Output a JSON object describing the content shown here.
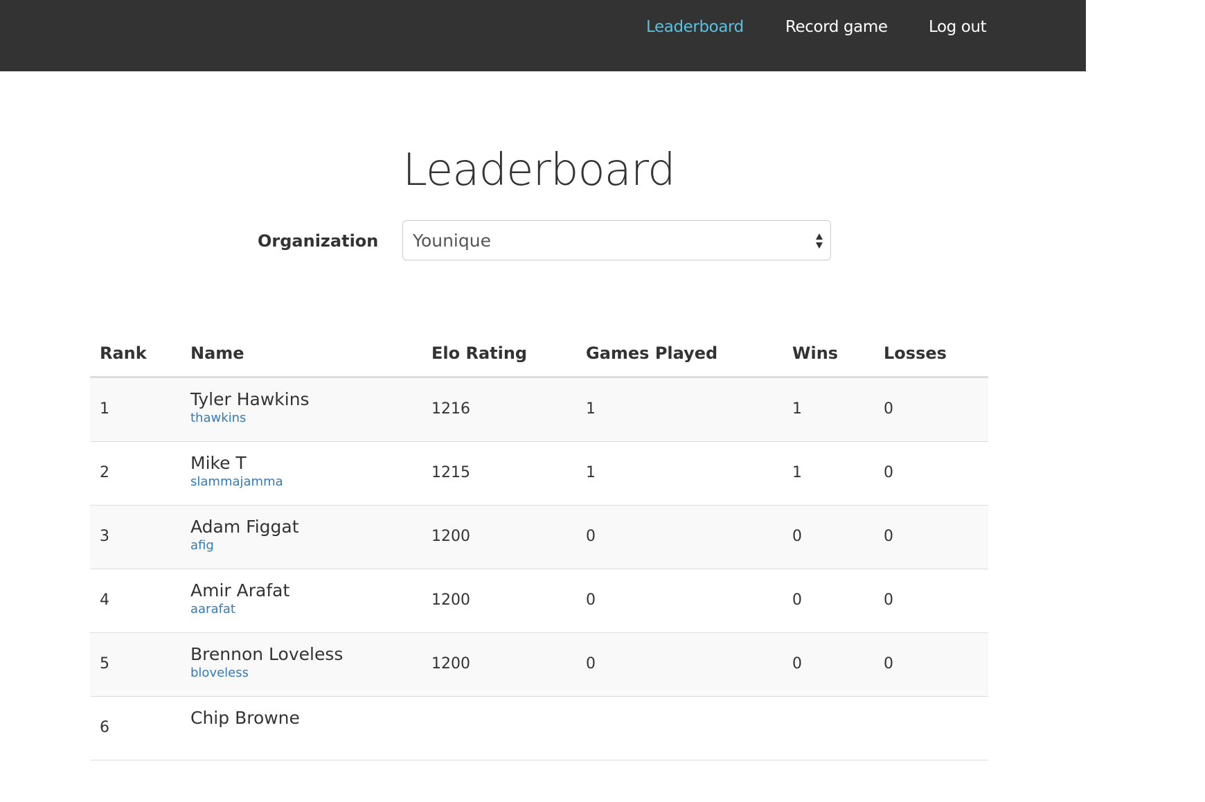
{
  "nav": {
    "items": [
      {
        "label": "Leaderboard",
        "active": true
      },
      {
        "label": "Record game",
        "active": false
      },
      {
        "label": "Log out",
        "active": false
      }
    ]
  },
  "page": {
    "title": "Leaderboard"
  },
  "organization": {
    "label": "Organization",
    "selected": "Younique"
  },
  "table": {
    "headers": {
      "rank": "Rank",
      "name": "Name",
      "elo": "Elo Rating",
      "games": "Games Played",
      "wins": "Wins",
      "losses": "Losses"
    },
    "rows": [
      {
        "rank": "1",
        "name": "Tyler Hawkins",
        "username": "thawkins",
        "elo": "1216",
        "games": "1",
        "wins": "1",
        "losses": "0"
      },
      {
        "rank": "2",
        "name": "Mike T",
        "username": "slammajamma",
        "elo": "1215",
        "games": "1",
        "wins": "1",
        "losses": "0"
      },
      {
        "rank": "3",
        "name": "Adam Figgat",
        "username": "afig",
        "elo": "1200",
        "games": "0",
        "wins": "0",
        "losses": "0"
      },
      {
        "rank": "4",
        "name": "Amir Arafat",
        "username": "aarafat",
        "elo": "1200",
        "games": "0",
        "wins": "0",
        "losses": "0"
      },
      {
        "rank": "5",
        "name": "Brennon Loveless",
        "username": "bloveless",
        "elo": "1200",
        "games": "0",
        "wins": "0",
        "losses": "0"
      },
      {
        "rank": "6",
        "name": "Chip Browne",
        "username": "",
        "elo": "",
        "games": "",
        "wins": "",
        "losses": ""
      }
    ]
  },
  "colors": {
    "navbar_bg": "#333333",
    "nav_active": "#5bc0de",
    "link": "#337ab7",
    "stripe": "#f9f9f9"
  }
}
